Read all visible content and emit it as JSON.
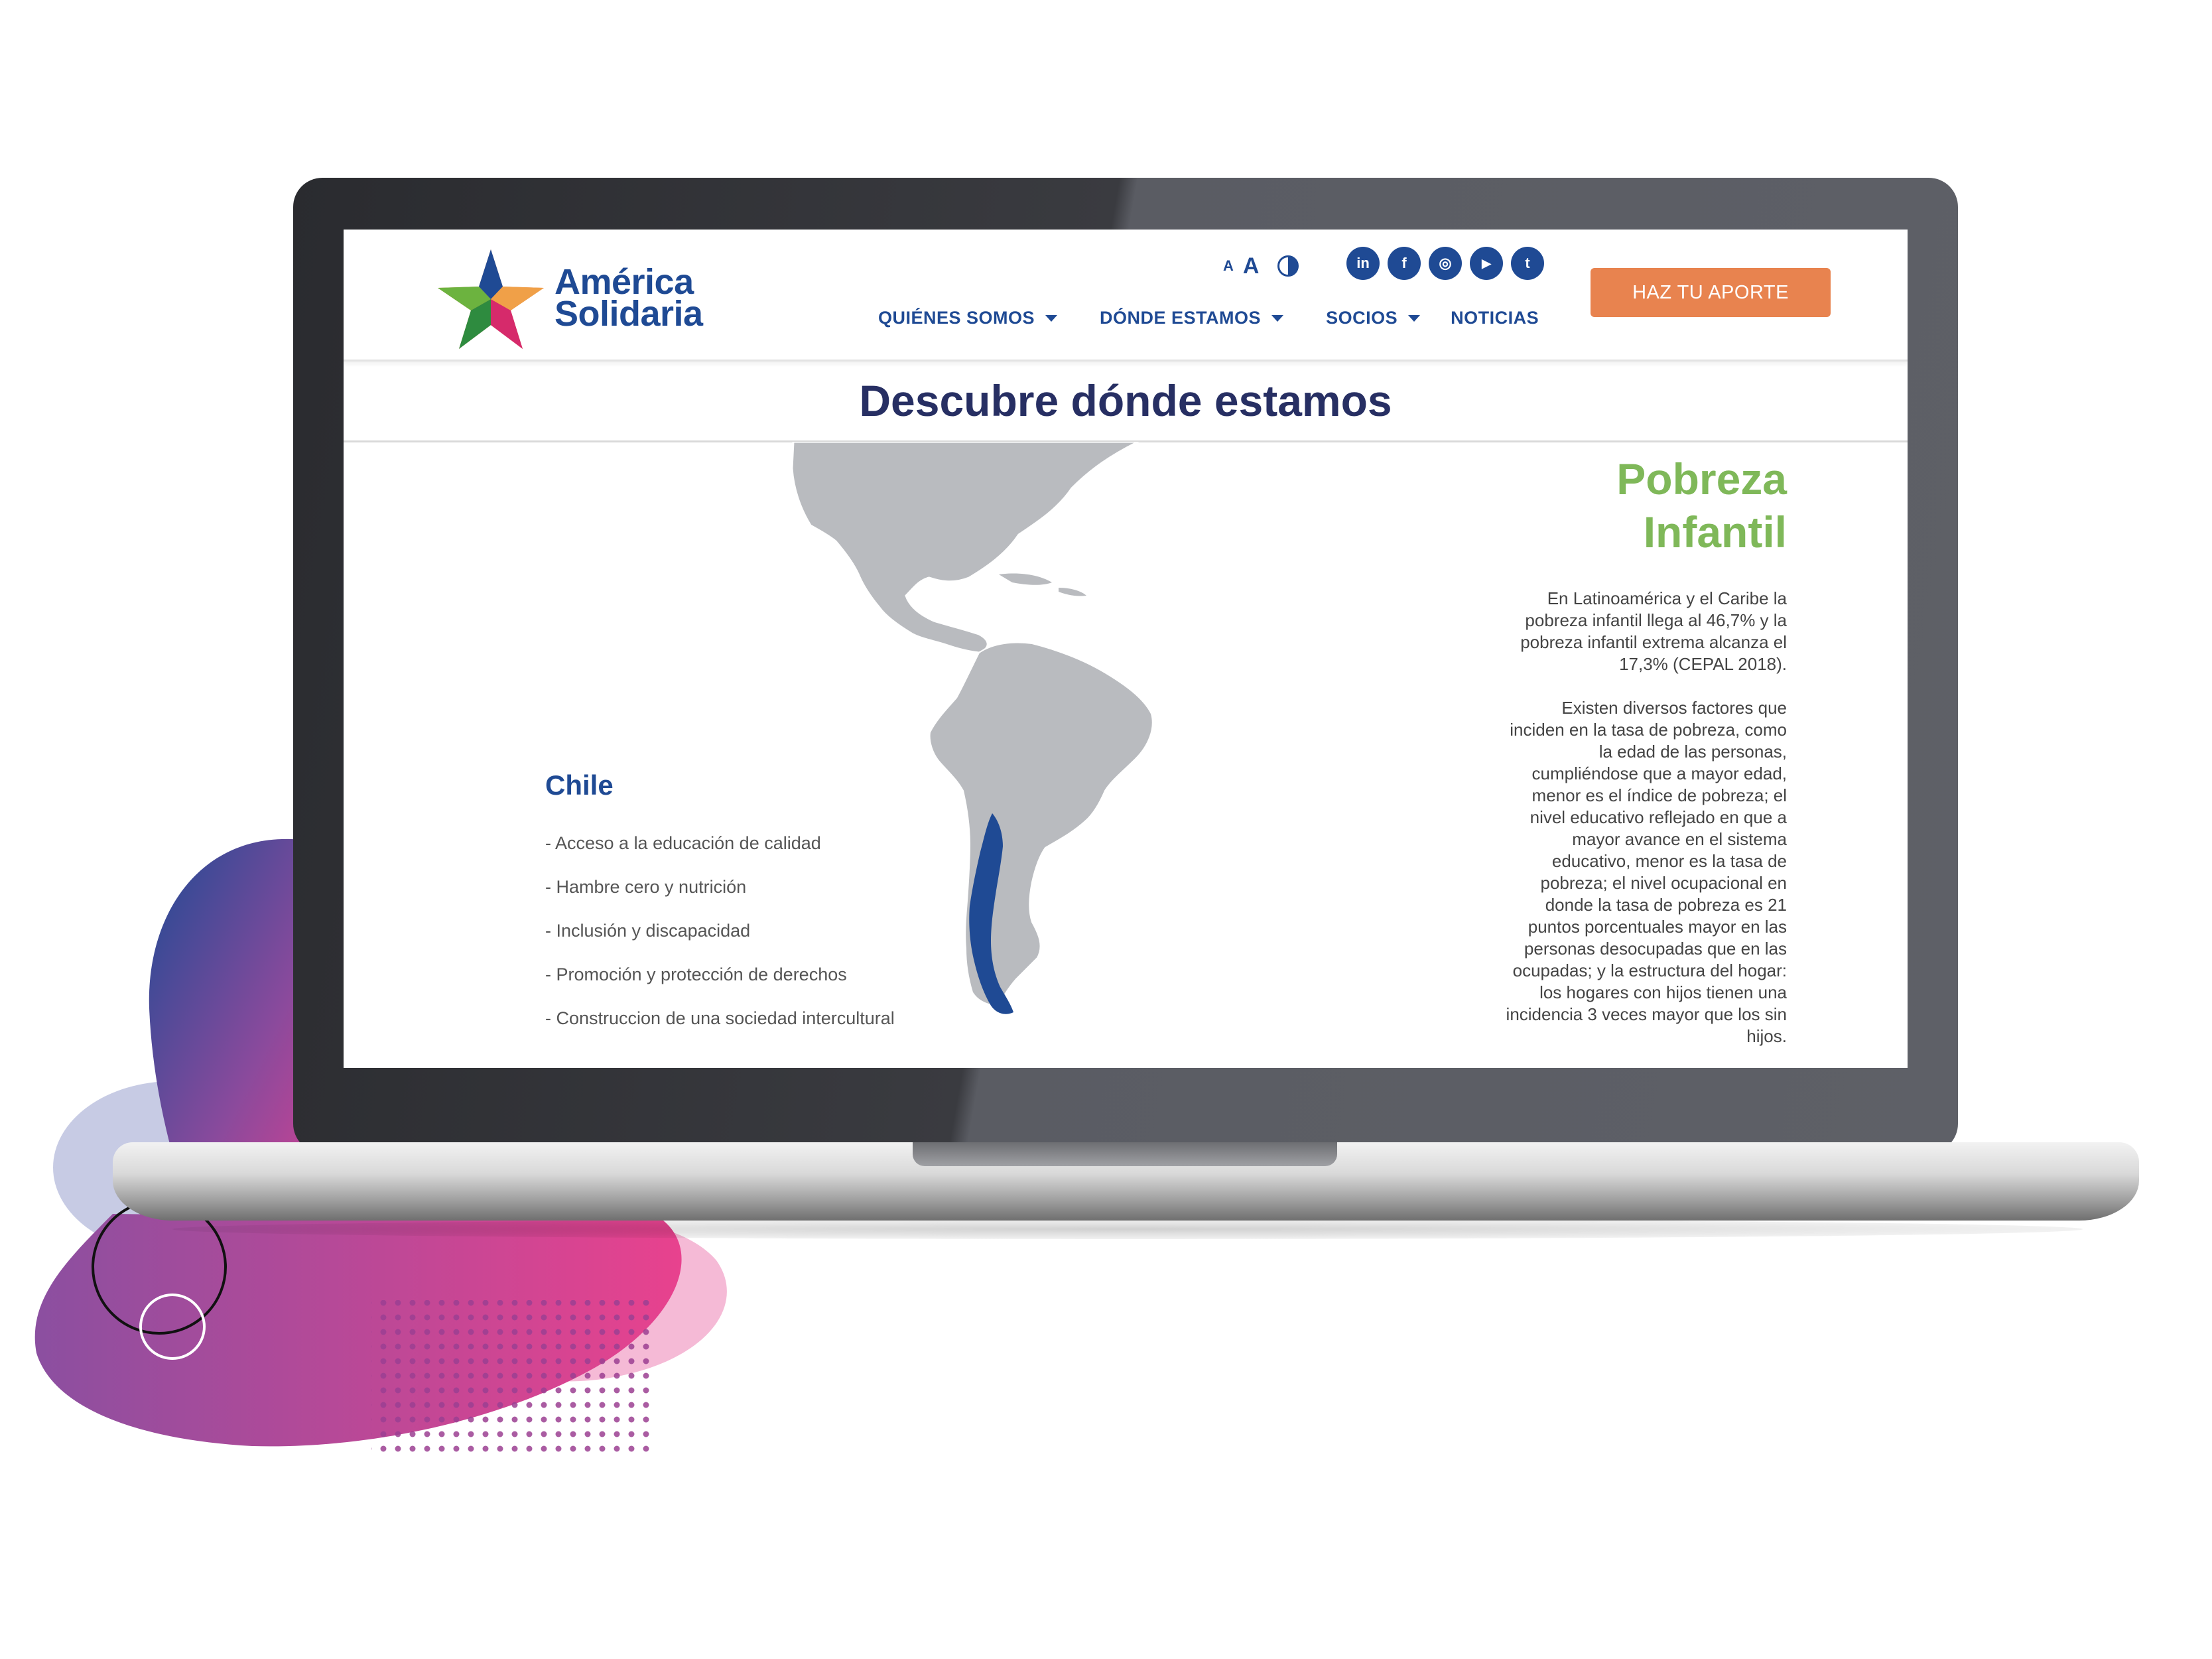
{
  "header": {
    "logo_line1": "América",
    "logo_line2": "Solidaria",
    "accessibility": {
      "small_a": "A",
      "big_a": "A"
    },
    "social": [
      "in",
      "f",
      "◎",
      "▶",
      "t"
    ],
    "nav": [
      "QUIÉNES SOMOS",
      "DÓNDE ESTAMOS",
      "SOCIOS",
      "NOTICIAS"
    ],
    "cta": "HAZ TU APORTE"
  },
  "main": {
    "title": "Descubre dónde estamos",
    "country": "Chile",
    "programs": [
      "- Acceso a la educación de calidad",
      "- Hambre cero y nutrición",
      "- Inclusión y discapacidad",
      "- Promoción y protección de derechos",
      "- Construccion de una sociedad intercultural"
    ],
    "topic_line1": "Pobreza",
    "topic_line2": "Infantil",
    "paragraph1": [
      "En Latinoamérica y el Caribe la",
      "pobreza infantil llega al 46,7% y la",
      "pobreza infantil extrema alcanza el",
      "17,3% (CEPAL 2018)."
    ],
    "paragraph2": [
      "Existen diversos factores que",
      "inciden en la tasa de pobreza, como",
      "la edad de las personas,",
      "cumpliéndose que a mayor edad,",
      "menor es el índice de pobreza; el",
      "nivel educativo reflejado en que a",
      "mayor avance en el sistema",
      "educativo, menor es la tasa de",
      "pobreza; el nivel ocupacional en",
      "donde la tasa de pobreza es 21",
      "puntos porcentuales mayor en las",
      "personas desocupadas que en las",
      "ocupadas; y la estructura del hogar:",
      "los hogares con hijos tienen una",
      "incidencia 3 veces mayor que los sin",
      "hijos."
    ]
  },
  "colors": {
    "brand_blue": "#1f4a94",
    "title_navy": "#272f63",
    "accent_green": "#7fb859",
    "cta_orange": "#e8834f",
    "map_gray": "#b9bbbf",
    "highlight_country": "#1f4a94"
  },
  "icons": [
    "star-logo-icon",
    "contrast-icon",
    "linkedin-icon",
    "facebook-icon",
    "instagram-icon",
    "youtube-icon",
    "twitter-icon",
    "caret-down-icon"
  ]
}
